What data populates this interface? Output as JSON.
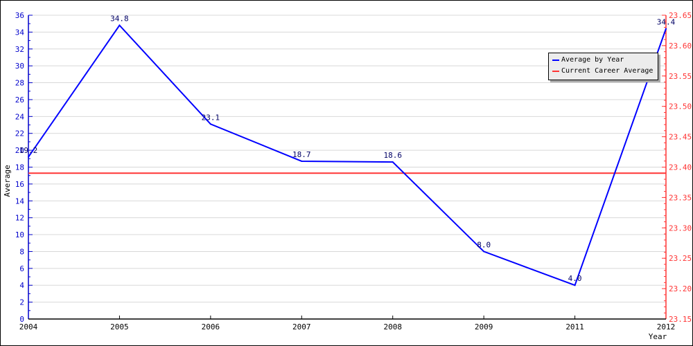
{
  "chart_data": {
    "type": "line",
    "title": "",
    "xlabel": "Year",
    "ylabel": "Average",
    "categories": [
      "2004",
      "2005",
      "2006",
      "2007",
      "2008",
      "2009",
      "2011",
      "2012"
    ],
    "series": [
      {
        "name": "Average by Year",
        "axis": "left",
        "color": "#0000ff",
        "values": [
          19.2,
          34.8,
          23.1,
          18.7,
          18.6,
          8.0,
          4.0,
          34.4
        ],
        "labels": [
          "19.2",
          "34.8",
          "23.1",
          "18.7",
          "18.6",
          "8.0",
          "4.0",
          "34.4"
        ]
      },
      {
        "name": "Current Career Average",
        "axis": "right",
        "color": "#ff3333",
        "value": 23.39
      }
    ],
    "ylim": [
      0,
      36
    ],
    "yticks": [
      "0",
      "2",
      "4",
      "6",
      "8",
      "10",
      "12",
      "14",
      "16",
      "18",
      "20",
      "22",
      "24",
      "26",
      "28",
      "30",
      "32",
      "34",
      "36"
    ],
    "y2lim": [
      23.15,
      23.65
    ],
    "y2ticks": [
      "23.15",
      "23.20",
      "23.25",
      "23.30",
      "23.35",
      "23.40",
      "23.45",
      "23.50",
      "23.55",
      "23.60",
      "23.65"
    ],
    "grid": true,
    "legend": "top-right"
  },
  "colors": {
    "left_axis": "#0000cc",
    "right_axis": "#ff3333",
    "grid": "#d8d8d8"
  }
}
